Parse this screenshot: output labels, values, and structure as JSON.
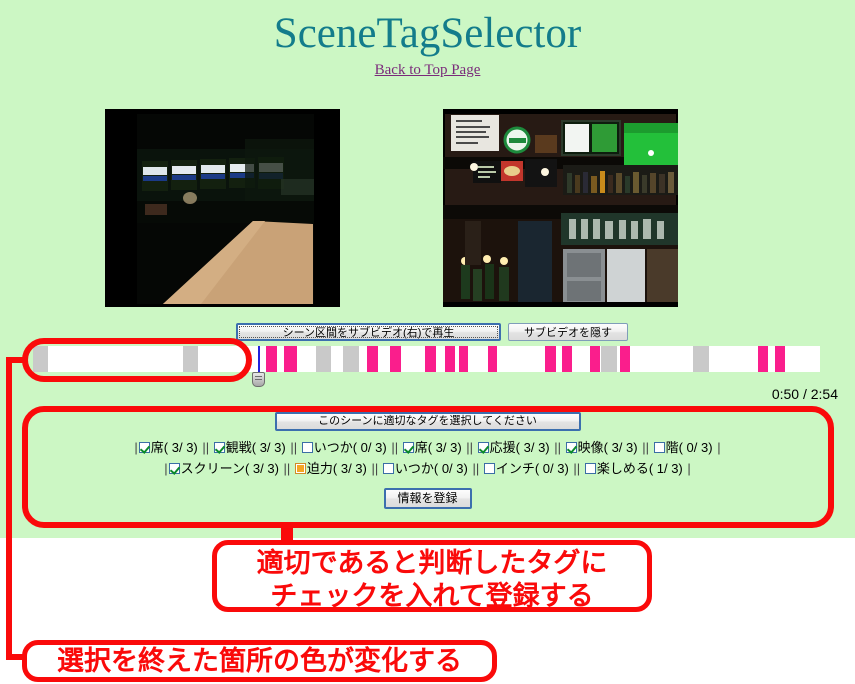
{
  "page": {
    "title": "SceneTagSelector",
    "back_link": "Back to Top Page",
    "bg_color": "#ccf7c4",
    "title_color": "#137c8b",
    "link_color": "#7a2a7a"
  },
  "videos": [
    {
      "name": "main-video",
      "description": "dark bar interior with row of lit windows and wooden table"
    },
    {
      "name": "sub-video",
      "description": "dark pub interior with bottles, TV screens showing green soccer pitch"
    }
  ],
  "toolbar": {
    "play_sub_label": "シーン区間をサブビデオ(右)で再生",
    "hide_sub_label": "サブビデオを隠す"
  },
  "timeline": {
    "time_display": "0:50 / 2:54",
    "done_color": "#c9c9c9",
    "todo_color": "#fa1e8c",
    "playhead_color": "#2222dd",
    "playhead_pct": 28.6,
    "handle_pct": 28.6,
    "done_marks": [
      {
        "left_pct": 0.0,
        "width_pct": 1.9
      },
      {
        "left_pct": 19.1,
        "width_pct": 1.9
      },
      {
        "left_pct": 36.0,
        "width_pct": 1.9
      },
      {
        "left_pct": 39.4,
        "width_pct": 2.0
      },
      {
        "left_pct": 72.2,
        "width_pct": 2.0
      },
      {
        "left_pct": 83.9,
        "width_pct": 2.0
      }
    ],
    "todo_marks": [
      {
        "left_pct": 29.6,
        "width_pct": 1.4
      },
      {
        "left_pct": 31.9,
        "width_pct": 1.6
      },
      {
        "left_pct": 42.4,
        "width_pct": 1.4
      },
      {
        "left_pct": 45.3,
        "width_pct": 1.4
      },
      {
        "left_pct": 49.8,
        "width_pct": 1.4
      },
      {
        "left_pct": 52.4,
        "width_pct": 1.2
      },
      {
        "left_pct": 54.1,
        "width_pct": 1.2
      },
      {
        "left_pct": 57.8,
        "width_pct": 1.2
      },
      {
        "left_pct": 65.1,
        "width_pct": 1.3
      },
      {
        "left_pct": 67.2,
        "width_pct": 1.3
      },
      {
        "left_pct": 70.8,
        "width_pct": 1.3
      },
      {
        "left_pct": 74.6,
        "width_pct": 1.3
      },
      {
        "left_pct": 92.1,
        "width_pct": 1.3
      },
      {
        "left_pct": 94.3,
        "width_pct": 1.3
      }
    ]
  },
  "tags": {
    "prompt_label": "このシーンに適切なタグを選択してください",
    "register_label": "情報を登録",
    "row1": [
      {
        "label": "席",
        "count": "( 3/ 3)",
        "state": "checked"
      },
      {
        "label": "観戦",
        "count": "( 3/ 3)",
        "state": "checked"
      },
      {
        "label": "いつか",
        "count": "( 0/ 3)",
        "state": "unchecked"
      },
      {
        "label": "席",
        "count": "( 3/ 3)",
        "state": "checked"
      },
      {
        "label": "応援",
        "count": "( 3/ 3)",
        "state": "checked"
      },
      {
        "label": "映像",
        "count": "( 3/ 3)",
        "state": "checked"
      },
      {
        "label": "階",
        "count": "( 0/ 3)",
        "state": "unchecked"
      }
    ],
    "row2": [
      {
        "label": "スクリーン",
        "count": "( 3/ 3)",
        "state": "checked"
      },
      {
        "label": "迫力",
        "count": "( 3/ 3)",
        "state": "partial"
      },
      {
        "label": "いつか",
        "count": "( 0/ 3)",
        "state": "unchecked"
      },
      {
        "label": "インチ",
        "count": "( 0/ 3)",
        "state": "unchecked"
      },
      {
        "label": "楽しめる",
        "count": "( 1/ 3)",
        "state": "unchecked"
      }
    ]
  },
  "annotations": {
    "color": "#fa0a0a",
    "callout_top_line1": "適切であると判断したタグに",
    "callout_top_line2": "チェックを入れて登録する",
    "callout_bottom": "選択を終えた箇所の色が変化する"
  }
}
